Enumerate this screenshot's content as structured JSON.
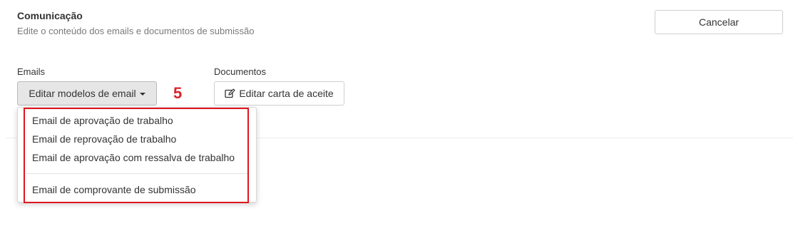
{
  "section": {
    "title": "Comunicação",
    "subtitle": "Edite o conteúdo dos emails e documentos de submissão"
  },
  "header": {
    "cancel_label": "Cancelar"
  },
  "emails": {
    "label": "Emails",
    "dropdown_label": "Editar modelos de email",
    "menu_items": [
      "Email de aprovação de trabalho",
      "Email de reprovação de trabalho",
      "Email de aprovação com ressalva de trabalho",
      "Email de comprovante de submissão"
    ]
  },
  "documents": {
    "label": "Documentos",
    "edit_letter_label": "Editar carta de aceite",
    "edit_icon": "edit-icon"
  },
  "annotation": {
    "step_number": "5",
    "highlight_color": "#e0161e"
  }
}
